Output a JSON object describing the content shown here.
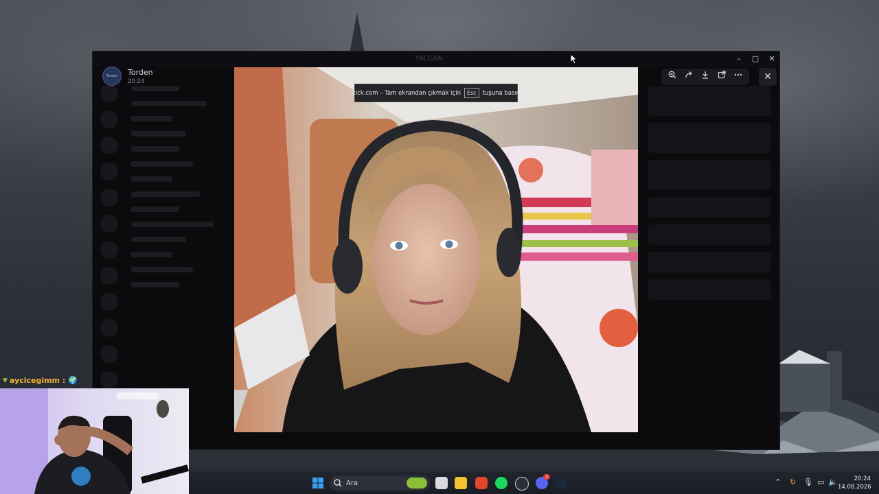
{
  "viewer": {
    "user_name": "Torden",
    "time": "20:24",
    "avatar_text": "Torden"
  },
  "window": {
    "title": "YALGAN",
    "min_glyph": "–",
    "max_glyph": "▢",
    "close_glyph": "✕"
  },
  "fullscreen_toast": {
    "before": "kick.com – Tam ekrandan çıkmak için",
    "key": "Esc",
    "after": "tuşuna basın"
  },
  "image_toolbar": {
    "zoom_icon": "zoom-in-icon",
    "forward_icon": "forward-icon",
    "download_icon": "download-icon",
    "open_icon": "open-external-icon",
    "more_icon": "more-icon",
    "close_icon": "close-icon"
  },
  "chat_overlay": {
    "author": "aycicegimm :",
    "emoji": "🌍"
  },
  "taskbar": {
    "search_placeholder": "Ara",
    "time": "20:24",
    "date": "14.08.2026",
    "discord_badge": "1"
  },
  "colors": {
    "discord_bg": "#0b0b0e",
    "toast_bg": "#141418",
    "chat_author": "#f2b233",
    "taskbar": "#1c1f26"
  }
}
